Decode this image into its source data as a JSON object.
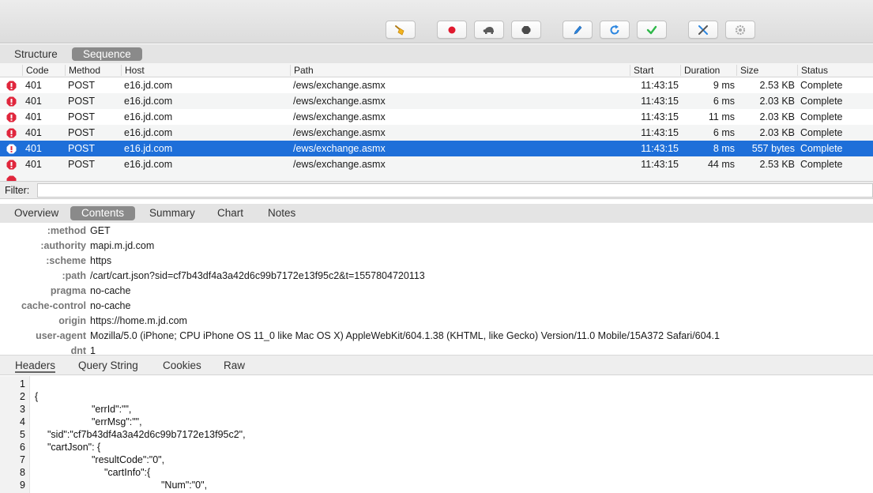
{
  "view_tabs": {
    "structure": "Structure",
    "sequence": "Sequence"
  },
  "table": {
    "columns": {
      "code": "Code",
      "method": "Method",
      "host": "Host",
      "path": "Path",
      "start": "Start",
      "duration": "Duration",
      "size": "Size",
      "status": "Status"
    },
    "rows": [
      {
        "code": "401",
        "method": "POST",
        "host": "e16.jd.com",
        "path": "/ews/exchange.asmx",
        "start": "11:43:15",
        "duration": "9 ms",
        "size": "2.53 KB",
        "status": "Complete"
      },
      {
        "code": "401",
        "method": "POST",
        "host": "e16.jd.com",
        "path": "/ews/exchange.asmx",
        "start": "11:43:15",
        "duration": "6 ms",
        "size": "2.03 KB",
        "status": "Complete"
      },
      {
        "code": "401",
        "method": "POST",
        "host": "e16.jd.com",
        "path": "/ews/exchange.asmx",
        "start": "11:43:15",
        "duration": "11 ms",
        "size": "2.03 KB",
        "status": "Complete"
      },
      {
        "code": "401",
        "method": "POST",
        "host": "e16.jd.com",
        "path": "/ews/exchange.asmx",
        "start": "11:43:15",
        "duration": "6 ms",
        "size": "2.03 KB",
        "status": "Complete"
      },
      {
        "code": "401",
        "method": "POST",
        "host": "e16.jd.com",
        "path": "/ews/exchange.asmx",
        "start": "11:43:15",
        "duration": "8 ms",
        "size": "557 bytes",
        "status": "Complete"
      },
      {
        "code": "401",
        "method": "POST",
        "host": "e16.jd.com",
        "path": "/ews/exchange.asmx",
        "start": "11:43:15",
        "duration": "44 ms",
        "size": "2.53 KB",
        "status": "Complete"
      }
    ],
    "selected_row": 4
  },
  "filter": {
    "label": "Filter:",
    "value": ""
  },
  "detail_tabs": {
    "overview": "Overview",
    "contents": "Contents",
    "summary": "Summary",
    "chart": "Chart",
    "notes": "Notes"
  },
  "headers": [
    {
      "key": ":method",
      "value": "GET"
    },
    {
      "key": ":authority",
      "value": "mapi.m.jd.com"
    },
    {
      "key": ":scheme",
      "value": "https"
    },
    {
      "key": ":path",
      "value": "/cart/cart.json?sid=cf7b43df4a3a42d6c99b7172e13f95c2&t=1557804720113"
    },
    {
      "key": "pragma",
      "value": "no-cache"
    },
    {
      "key": "cache-control",
      "value": "no-cache"
    },
    {
      "key": "origin",
      "value": "https://home.m.jd.com"
    },
    {
      "key": "user-agent",
      "value": "Mozilla/5.0 (iPhone; CPU iPhone OS 11_0 like Mac OS X) AppleWebKit/604.1.38 (KHTML, like Gecko) Version/11.0 Mobile/15A372 Safari/604.1"
    },
    {
      "key": "dnt",
      "value": "1"
    }
  ],
  "bottom_tabs": {
    "headers": "Headers",
    "query_string": "Query String",
    "cookies": "Cookies",
    "raw": "Raw"
  },
  "code_lines": [
    {
      "n": "1",
      "text": ""
    },
    {
      "n": "2",
      "text": "{"
    },
    {
      "n": "3",
      "text": "\"errId\":\"\","
    },
    {
      "n": "4",
      "text": "\"errMsg\":\"\","
    },
    {
      "n": "5",
      "text": "\"sid\":\"cf7b43df4a3a42d6c99b7172e13f95c2\","
    },
    {
      "n": "6",
      "text": "\"cartJson\": {"
    },
    {
      "n": "7",
      "text": "\"resultCode\":\"0\","
    },
    {
      "n": "8",
      "text": "\"cartInfo\":{"
    },
    {
      "n": "9",
      "text": "\"Num\":\"0\","
    }
  ],
  "colors": {
    "selection": "#1e6fd9",
    "error_icon": "#e0263c",
    "record": "#e0192e",
    "check": "#2fb84a",
    "refresh": "#2b86e0"
  },
  "icons": [
    "broom-icon",
    "record-icon",
    "turtle-icon",
    "stop-hexagon-icon",
    "pen-icon",
    "refresh-icon",
    "check-icon",
    "tools-icon",
    "settings-gear-icon",
    "error-hexagon-icon"
  ]
}
